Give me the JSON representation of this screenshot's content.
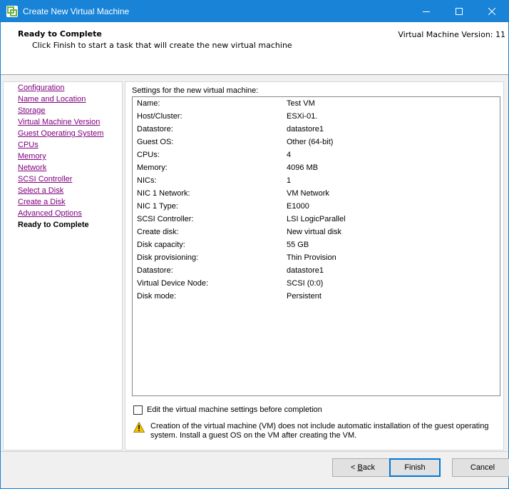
{
  "window": {
    "title": "Create New Virtual Machine",
    "accent_color": "#1883d7"
  },
  "header": {
    "title": "Ready to Complete",
    "subtitle": "Click Finish to start a task that will create the new virtual machine",
    "version": "Virtual Machine Version: 11"
  },
  "nav": {
    "items": [
      {
        "label": "Configuration"
      },
      {
        "label": "Name and Location"
      },
      {
        "label": "Storage"
      },
      {
        "label": "Virtual Machine Version"
      },
      {
        "label": "Guest Operating System"
      },
      {
        "label": "CPUs"
      },
      {
        "label": "Memory"
      },
      {
        "label": "Network"
      },
      {
        "label": "SCSI Controller"
      },
      {
        "label": "Select a Disk"
      },
      {
        "label": "Create a Disk"
      },
      {
        "label": "Advanced Options"
      },
      {
        "label": "Ready to Complete"
      }
    ]
  },
  "settings": {
    "label": "Settings for the new virtual machine:",
    "rows": [
      {
        "key": "Name:",
        "value": "Test VM"
      },
      {
        "key": "Host/Cluster:",
        "value": "ESXi-01."
      },
      {
        "key": "Datastore:",
        "value": "datastore1"
      },
      {
        "key": "Guest OS:",
        "value": "Other (64-bit)"
      },
      {
        "key": "CPUs:",
        "value": "4"
      },
      {
        "key": "Memory:",
        "value": "4096 MB"
      },
      {
        "key": "NICs:",
        "value": "1"
      },
      {
        "key": "NIC 1 Network:",
        "value": "VM Network"
      },
      {
        "key": "NIC 1 Type:",
        "value": "E1000"
      },
      {
        "key": "SCSI Controller:",
        "value": "LSI LogicParallel"
      },
      {
        "key": "Create disk:",
        "value": "New virtual disk"
      },
      {
        "key": "Disk capacity:",
        "value": "55 GB"
      },
      {
        "key": "Disk provisioning:",
        "value": "Thin Provision"
      },
      {
        "key": "Datastore:",
        "value": "datastore1"
      },
      {
        "key": "Virtual Device Node:",
        "value": "SCSI (0:0)"
      },
      {
        "key": "Disk mode:",
        "value": "Persistent"
      }
    ]
  },
  "edit_checkbox": {
    "label": "Edit the virtual machine settings before completion"
  },
  "warning": {
    "text": "Creation of the virtual machine (VM) does not include automatic installation of the guest operating system. Install a guest OS on the VM after creating the VM.",
    "icon": "warning-icon"
  },
  "buttons": {
    "back_prefix": "<",
    "back_underlined": "B",
    "back_rest": "ack",
    "finish": "Finish",
    "cancel": "Cancel"
  }
}
